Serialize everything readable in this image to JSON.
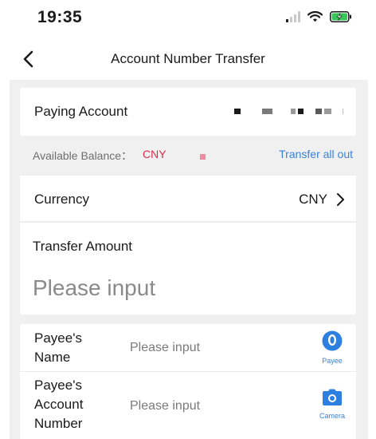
{
  "status_bar": {
    "time": "19:35"
  },
  "nav": {
    "title": "Account Number Transfer"
  },
  "paying_account": {
    "label": "Paying Account"
  },
  "balance": {
    "label": "Available Balance：",
    "currency": "CNY",
    "transfer_all": "Transfer all out"
  },
  "currency": {
    "label": "Currency",
    "value": "CNY"
  },
  "amount": {
    "label": "Transfer Amount",
    "placeholder": "Please input"
  },
  "payee": {
    "name_label": "Payee's Name",
    "name_placeholder": "Please input",
    "name_button": "Payee",
    "account_label": "Payee's Account Number",
    "account_placeholder": "Please input",
    "account_button": "Camera"
  },
  "colors": {
    "accent": "#3a82d8",
    "balance_currency": "#e0284a",
    "background_gray": "#f0f0f0"
  },
  "icons": [
    "signal-icon",
    "wifi-icon",
    "battery-charging-icon",
    "back-icon",
    "chevron-right-icon",
    "payee-contact-icon",
    "camera-icon"
  ]
}
